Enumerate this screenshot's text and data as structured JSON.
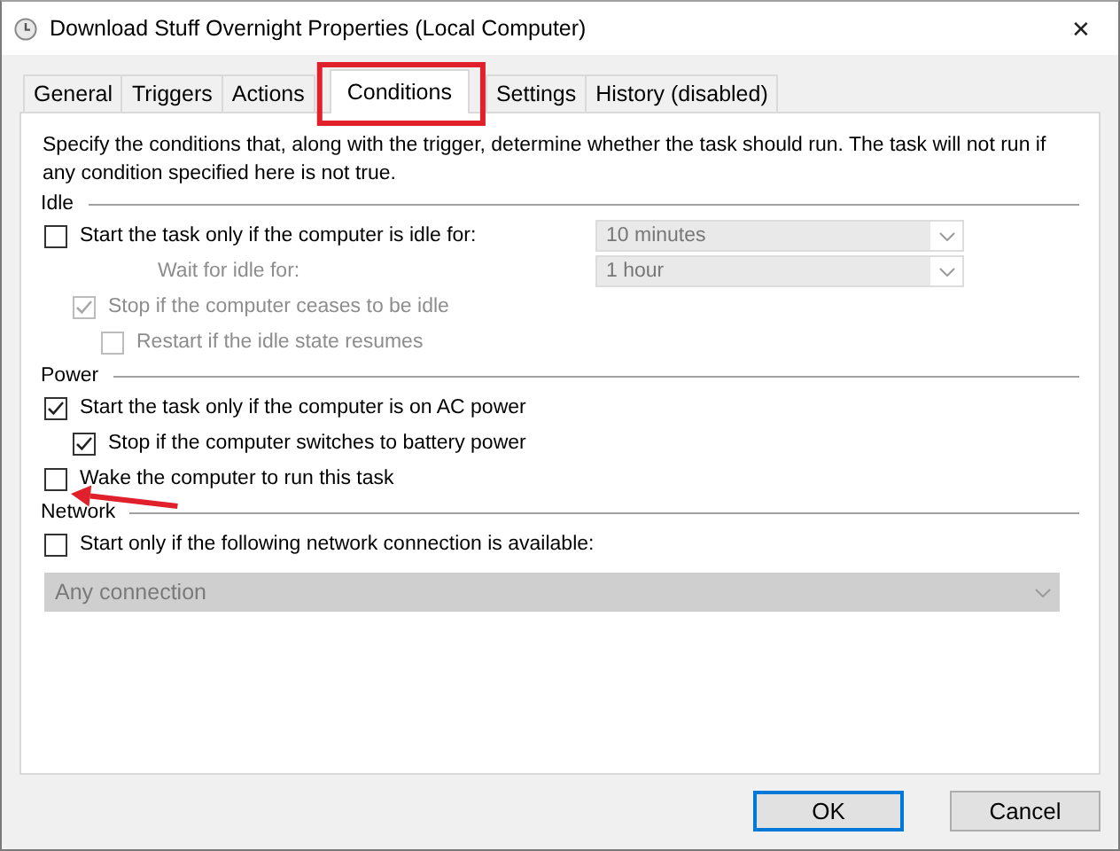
{
  "window": {
    "title": "Download Stuff Overnight Properties (Local Computer)",
    "close": "✕"
  },
  "tabs": [
    {
      "label": "General",
      "selected": false
    },
    {
      "label": "Triggers",
      "selected": false
    },
    {
      "label": "Actions",
      "selected": false
    },
    {
      "label": "Conditions",
      "selected": true
    },
    {
      "label": "Settings",
      "selected": false
    },
    {
      "label": "History (disabled)",
      "selected": false
    }
  ],
  "description": "Specify the conditions that, along with the trigger, determine whether the task should run.  The task will not run  if any condition specified here is not true.",
  "sections": [
    {
      "title": "Idle",
      "items": [
        {
          "kind": "checkbox",
          "label": "Start the task only if the computer is idle for:",
          "checked": false,
          "disabled": false,
          "dropdown": {
            "value": "10 minutes",
            "disabled": true
          },
          "children": [
            {
              "kind": "labeled-dropdown",
              "label": "Wait for idle for:",
              "disabled": true,
              "dropdown": {
                "value": "1 hour",
                "disabled": true
              }
            },
            {
              "kind": "checkbox",
              "label": "Stop if the computer ceases to be idle",
              "checked": true,
              "disabled": true,
              "children": [
                {
                  "kind": "checkbox",
                  "label": "Restart if the idle state resumes",
                  "checked": false,
                  "disabled": true
                }
              ]
            }
          ]
        }
      ]
    },
    {
      "title": "Power",
      "items": [
        {
          "kind": "checkbox",
          "label": "Start the task only if the computer is on AC power",
          "checked": true,
          "disabled": false,
          "children": [
            {
              "kind": "checkbox",
              "label": "Stop if the computer switches to battery power",
              "checked": true,
              "disabled": false
            }
          ]
        },
        {
          "kind": "checkbox",
          "label": "Wake the computer to run this task",
          "checked": false,
          "disabled": false
        }
      ]
    },
    {
      "title": "Network",
      "items": [
        {
          "kind": "checkbox",
          "label": "Start only if the following network connection is available:",
          "checked": false,
          "disabled": false,
          "children": [
            {
              "kind": "wide-dropdown",
              "dropdown": {
                "value": "Any connection",
                "disabled": true
              }
            }
          ]
        }
      ]
    }
  ],
  "buttons": [
    {
      "label": "OK",
      "default": true
    },
    {
      "label": "Cancel",
      "default": false
    }
  ]
}
